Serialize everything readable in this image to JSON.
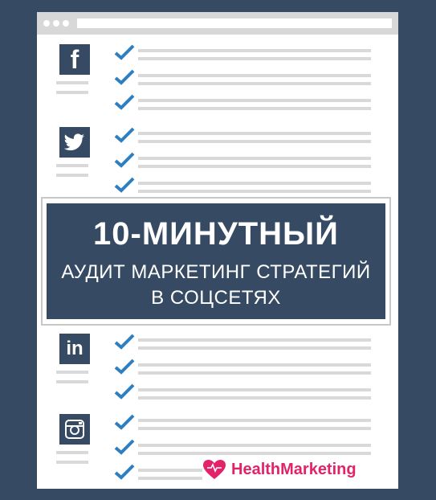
{
  "banner": {
    "line1": "10-МИНУТНЫЙ",
    "line2": "АУДИТ МАРКЕТИНГ СТРАТЕГИЙ",
    "line3": "В СОЦСЕТЯХ"
  },
  "sections": [
    {
      "icon": "facebook-icon",
      "glyph": "f"
    },
    {
      "icon": "twitter-icon",
      "glyph": ""
    },
    {
      "icon": "linkedin-icon",
      "glyph": "in"
    },
    {
      "icon": "instagram-icon",
      "glyph": ""
    }
  ],
  "brand": {
    "name": "HealthMarketing",
    "color": "#e2236a",
    "icon": "heart-icon"
  },
  "colors": {
    "background": "#364a63",
    "check": "#2e7fc1",
    "line": "#d9d9d9"
  }
}
